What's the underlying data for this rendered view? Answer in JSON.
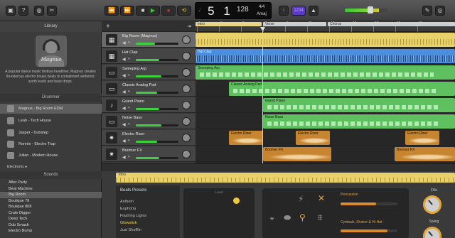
{
  "toolbar": {
    "buttons": {
      "library": "library-icon",
      "help": "help-icon",
      "smart_controls": "knob-icon",
      "editors": "scissors-icon",
      "rewind": "⏪",
      "forward": "⏩",
      "stop": "■",
      "play": "▶",
      "record": "●",
      "cycle": "cycle-icon",
      "tuner": "tuner-icon",
      "count_in": "metronome-icon",
      "smart_tempo": "1234",
      "loop_browser": "loop-icon",
      "media_browser": "media-icon"
    },
    "lcd": {
      "position_bar": "5",
      "position_beat": "1",
      "tempo": "128",
      "time_signature": "4/4",
      "key": "Amaj"
    },
    "master_volume": 0.55
  },
  "library": {
    "title": "Library",
    "patch_name": "Magnus",
    "description": "A popular dance music festival headliner, Magnus creates thunderous electro house beats to compliment anthemic synth leads and bass drops.",
    "drummer_title": "Drummer",
    "drummers": [
      {
        "name": "Magnus - Big Room EDM",
        "selected": true
      },
      {
        "name": "Leah - Tech House",
        "selected": false
      },
      {
        "name": "Jasper - Dubstep",
        "selected": false
      },
      {
        "name": "Ronnie - Electro Trap",
        "selected": false
      },
      {
        "name": "Julian - Modern House",
        "selected": false
      }
    ],
    "genre": "Electronic ▸",
    "sounds_title": "Sounds",
    "sounds": [
      {
        "name": "After Party",
        "selected": false
      },
      {
        "name": "Beat Machine",
        "selected": false
      },
      {
        "name": "Big Room",
        "selected": true
      },
      {
        "name": "Boutique 78",
        "selected": false
      },
      {
        "name": "Boutique 808",
        "selected": false
      },
      {
        "name": "Crate Digger",
        "selected": false
      },
      {
        "name": "Deep Tech",
        "selected": false
      },
      {
        "name": "Dub Smash",
        "selected": false
      },
      {
        "name": "Electro Bump",
        "selected": false
      }
    ]
  },
  "tracks": [
    {
      "name": "Big Room (Magnus)",
      "icon": "drum-machine-icon",
      "glyph": "▦",
      "volume": 0.45,
      "selected": true
    },
    {
      "name": "Hat Clap",
      "icon": "drum-machine-icon",
      "glyph": "▦",
      "volume": 0.55,
      "selected": false
    },
    {
      "name": "Sweeping Arp",
      "icon": "synth-icon",
      "glyph": "▭",
      "volume": 0.6,
      "selected": false
    },
    {
      "name": "Classic Analog Pad",
      "icon": "synth-icon",
      "glyph": "▭",
      "volume": 0.5,
      "selected": false
    },
    {
      "name": "Grand Piano",
      "icon": "piano-icon",
      "glyph": "♪",
      "volume": 0.55,
      "selected": false
    },
    {
      "name": "Noise Bass",
      "icon": "bass-synth-icon",
      "glyph": "▭",
      "volume": 0.6,
      "selected": false
    },
    {
      "name": "Electro Riser",
      "icon": "starburst-icon",
      "glyph": "✷",
      "volume": 0.5,
      "selected": false
    },
    {
      "name": "Boomer FX",
      "icon": "starburst-icon",
      "glyph": "✷",
      "volume": 0.55,
      "selected": false
    }
  ],
  "timeline": {
    "bars": [
      "1",
      "3",
      "5",
      "7",
      "9",
      "11",
      "13",
      "15",
      "17",
      "19",
      "21"
    ],
    "arrangement": [
      "Intro",
      "Verse",
      "Chorus"
    ],
    "regions": [
      {
        "lane": 0,
        "label": "",
        "color": "yellow"
      },
      {
        "lane": 1,
        "label": "Hat Clap",
        "color": "blue"
      },
      {
        "lane": 2,
        "label": "Sweeping Arp",
        "color": "green"
      },
      {
        "lane": 3,
        "label": "Classic Analog Pad",
        "color": "green"
      },
      {
        "lane": 4,
        "label": "Grand Piano",
        "color": "green"
      },
      {
        "lane": 5,
        "label": "Noise Bass",
        "color": "green"
      },
      {
        "lane": 6,
        "label": "Electro Riser",
        "color": "orange"
      },
      {
        "lane": 6,
        "label": "Electro Riser",
        "color": "orange"
      },
      {
        "lane": 6,
        "label": "Electro Riser",
        "color": "orange"
      },
      {
        "lane": 7,
        "label": "Boomer FX",
        "color": "orange"
      },
      {
        "lane": 7,
        "label": "Boomer FX",
        "color": "orange"
      },
      {
        "lane": 7,
        "label": "Boomer FX",
        "color": "orange"
      }
    ]
  },
  "editor": {
    "region_label": "Intro",
    "presets_title": "Beats Presets",
    "presets": [
      {
        "name": "Anthem",
        "active": false
      },
      {
        "name": "Euphoria",
        "active": false
      },
      {
        "name": "Flashing Lights",
        "active": false
      },
      {
        "name": "Glowstick",
        "active": true
      },
      {
        "name": "Just Shufflin",
        "active": false
      }
    ],
    "xy_label": "Loud",
    "percussion_label": "Percussion",
    "cymbals_label": "Cymbals, Shaker & Hi-Hat",
    "percussion_level": 0.62,
    "cymbals_level": 0.82,
    "fills_label": "Fills",
    "swing_label": "Swing"
  },
  "colors": {
    "accent_yellow": "#e8d06a",
    "accent_green": "#5ec05e",
    "accent_blue": "#4a8ee0",
    "accent_orange": "#c8852f"
  }
}
